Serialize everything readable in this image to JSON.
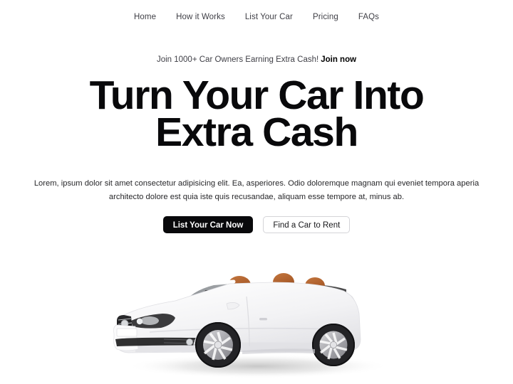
{
  "nav": {
    "items": [
      {
        "label": "Home"
      },
      {
        "label": "How it Works"
      },
      {
        "label": "List Your Car"
      },
      {
        "label": "Pricing"
      },
      {
        "label": "FAQs"
      }
    ]
  },
  "announcement": {
    "text": "Join 1000+ Car Owners Earning Extra Cash!",
    "cta_label": "Join now"
  },
  "hero": {
    "title_line1": "Turn Your Car Into",
    "title_line2": "Extra Cash",
    "description": "Lorem, ipsum dolor sit amet consectetur adipisicing elit. Ea, asperiores. Odio doloremque magnam qui eveniet tempora aperia architecto dolore est quia iste quis recusandae, aliquam esse tempore at, minus ab.",
    "primary_button": "List Your Car Now",
    "secondary_button": "Find a Car to Rent"
  },
  "illustration": {
    "name": "white convertible car, side-front three-quarter view, top down, tan leather seats",
    "body_color": "#ffffff",
    "body_shade": "#e4e4e7",
    "seat_color": "#b4662f",
    "wheel_color": "#a1a1aa",
    "tire_color": "#1f1f21",
    "glass_color": "#8e9296",
    "shadow_color": "#bfbfbf"
  },
  "theme": {
    "background": "#ffffff",
    "text_primary": "#09090b",
    "text_muted": "#3f3f46",
    "accent": "#09090b",
    "border": "#d4d4d8"
  }
}
